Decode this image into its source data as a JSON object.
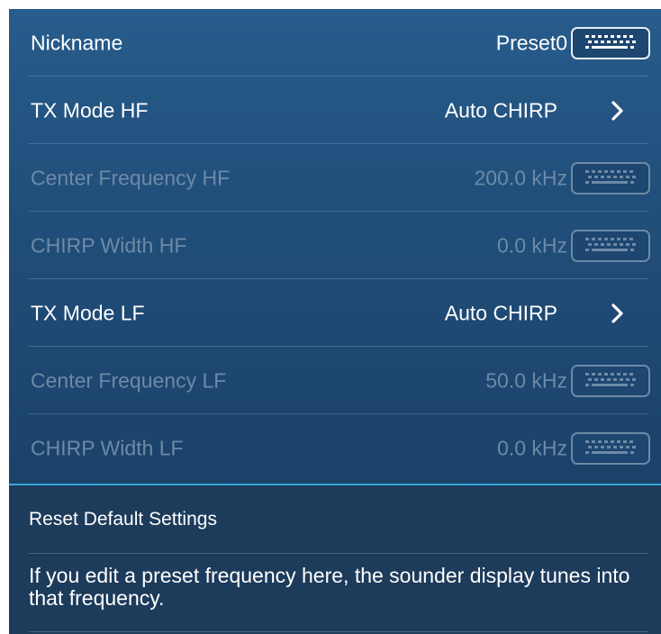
{
  "settings": {
    "rows": [
      {
        "label": "Nickname",
        "value": "Preset0",
        "control": "keyboard",
        "enabled": true
      },
      {
        "label": "TX Mode HF",
        "value": "Auto CHIRP",
        "control": "chevron",
        "enabled": true
      },
      {
        "label": "Center Frequency HF",
        "value": "200.0 kHz",
        "control": "keyboard",
        "enabled": false
      },
      {
        "label": "CHIRP Width HF",
        "value": "0.0 kHz",
        "control": "keyboard",
        "enabled": false
      },
      {
        "label": "TX Mode LF",
        "value": "Auto CHIRP",
        "control": "chevron",
        "enabled": true
      },
      {
        "label": "Center Frequency LF",
        "value": "50.0 kHz",
        "control": "keyboard",
        "enabled": false
      },
      {
        "label": "CHIRP Width LF",
        "value": "0.0 kHz",
        "control": "keyboard",
        "enabled": false
      }
    ]
  },
  "footer": {
    "reset_label": "Reset Default Settings",
    "info_text": "If you edit a preset frequency here, the sounder display tunes into that frequency."
  },
  "icons": {
    "keyboard": "keyboard-icon",
    "chevron": "chevron-right-icon"
  },
  "colors": {
    "enabled_text": "#ffffff",
    "disabled_text": "#6d8aa6",
    "accent_divider": "#36a9d6"
  }
}
